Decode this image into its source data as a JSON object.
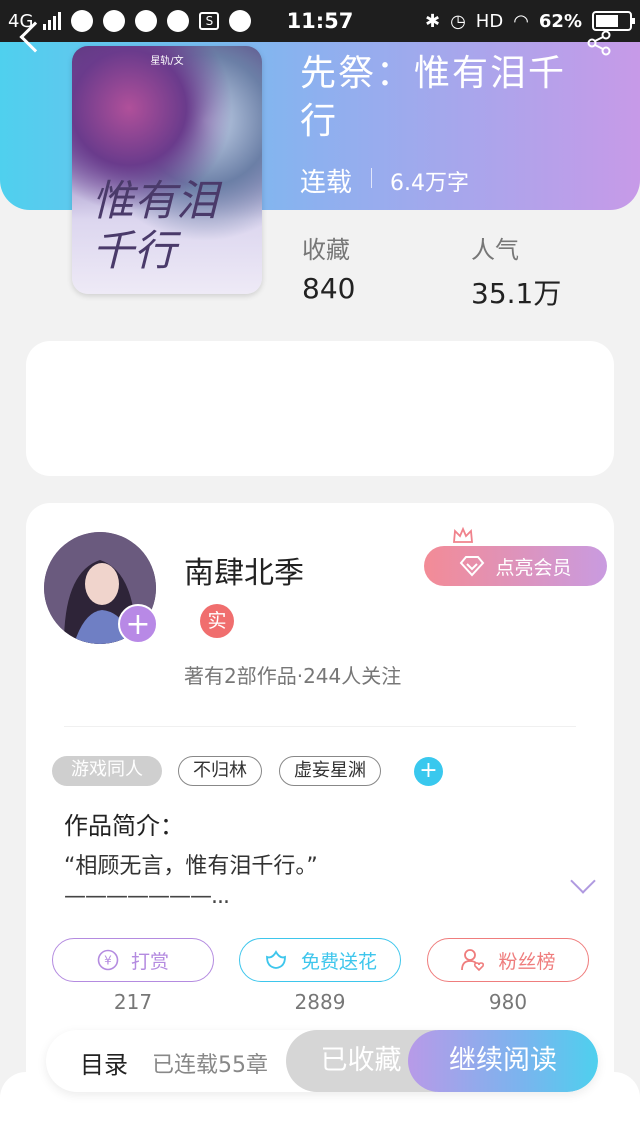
{
  "status_bar": {
    "network": "4G",
    "time": "11:57",
    "hd": "HD",
    "battery": "62%",
    "icons": [
      "signal-icon",
      "browser-icon",
      "qq-icon",
      "wechat-icon",
      "weather-icon",
      "s-icon",
      "message-icon",
      "bluetooth-icon",
      "alarm-icon",
      "wifi-icon",
      "battery-icon"
    ]
  },
  "book": {
    "title": "先祭：惟有泪千行",
    "status": "连载",
    "word_count": "6.4万字",
    "cover": {
      "author_line": "星轨/文",
      "title_art": "惟有泪千行"
    },
    "stats": [
      {
        "label": "收藏",
        "value": "840"
      },
      {
        "label": "人气",
        "value": "35.1万"
      }
    ]
  },
  "author": {
    "name": "南肆北季",
    "badge": "实",
    "meta": "著有2部作品·244人关注",
    "follow_icon": "+",
    "member_button": "点亮会员"
  },
  "tags": {
    "items": [
      "游戏同人",
      "不归林",
      "虚妄星渊"
    ],
    "add": "+"
  },
  "intro": {
    "heading": "作品简介：",
    "text_line1": "“相顾无言，惟有泪千行。”",
    "text_line2": "———————..."
  },
  "actions": [
    {
      "label": "打赏",
      "count": "217",
      "color": "#b48be0",
      "icon": "yen-icon"
    },
    {
      "label": "免费送花",
      "count": "2889",
      "color": "#3ec6ec",
      "icon": "flower-icon"
    },
    {
      "label": "粉丝榜",
      "count": "980",
      "color": "#ef7d7d",
      "icon": "fans-icon"
    }
  ],
  "bottom_bar": {
    "toc": "目录",
    "chapters": "已连载55章",
    "collected": "已收藏",
    "continue": "继续阅读"
  }
}
